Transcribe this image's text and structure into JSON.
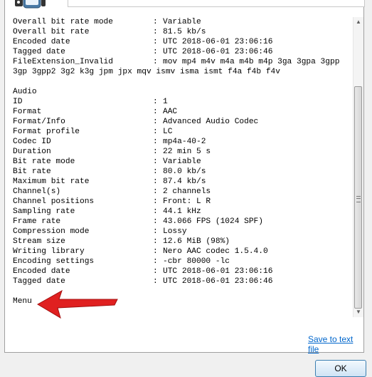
{
  "info_lines": [
    {
      "key": "Overall bit rate mode",
      "value": "Variable"
    },
    {
      "key": "Overall bit rate",
      "value": "81.5 kb/s"
    },
    {
      "key": "Encoded date",
      "value": "UTC 2018-06-01 23:06:16"
    },
    {
      "key": "Tagged date",
      "value": "UTC 2018-06-01 23:06:46"
    },
    {
      "key": "FileExtension_Invalid",
      "value": "mov mp4 m4v m4a m4b m4p 3ga 3gpa 3gpp"
    },
    {
      "key": "",
      "value": "",
      "text": "3gp 3gpp2 3g2 k3g jpm jpx mqv ismv isma ismt f4a f4b f4v"
    },
    {
      "key": "",
      "value": "",
      "text": ""
    },
    {
      "key": "",
      "value": "",
      "text": "Audio"
    },
    {
      "key": "ID",
      "value": "1"
    },
    {
      "key": "Format",
      "value": "AAC"
    },
    {
      "key": "Format/Info",
      "value": "Advanced Audio Codec"
    },
    {
      "key": "Format profile",
      "value": "LC"
    },
    {
      "key": "Codec ID",
      "value": "mp4a-40-2"
    },
    {
      "key": "Duration",
      "value": "22 min 5 s"
    },
    {
      "key": "Bit rate mode",
      "value": "Variable"
    },
    {
      "key": "Bit rate",
      "value": "80.0 kb/s"
    },
    {
      "key": "Maximum bit rate",
      "value": "87.4 kb/s"
    },
    {
      "key": "Channel(s)",
      "value": "2 channels"
    },
    {
      "key": "Channel positions",
      "value": "Front: L R"
    },
    {
      "key": "Sampling rate",
      "value": "44.1 kHz"
    },
    {
      "key": "Frame rate",
      "value": "43.066 FPS (1024 SPF)"
    },
    {
      "key": "Compression mode",
      "value": "Lossy"
    },
    {
      "key": "Stream size",
      "value": "12.6 MiB (98%)"
    },
    {
      "key": "Writing library",
      "value": "Nero AAC codec 1.5.4.0"
    },
    {
      "key": "Encoding settings",
      "value": "-cbr 80000 -lc"
    },
    {
      "key": "Encoded date",
      "value": "UTC 2018-06-01 23:06:16"
    },
    {
      "key": "Tagged date",
      "value": "UTC 2018-06-01 23:06:46"
    },
    {
      "key": "",
      "value": "",
      "text": ""
    },
    {
      "key": "",
      "value": "",
      "text": "Menu"
    }
  ],
  "separator": ":",
  "save_link": "Save to text file",
  "ok_label": "OK",
  "icons": {
    "app_icon": "mediainfo-film-icon",
    "arrow": "red-arrow-annotation-icon"
  },
  "colors": {
    "link": "#0066cc",
    "arrow": "#e02020"
  }
}
